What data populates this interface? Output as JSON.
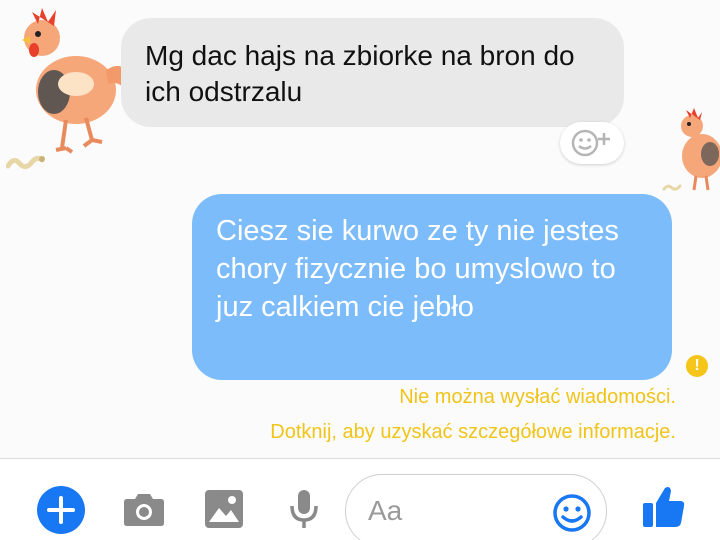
{
  "thread": {
    "incoming_message": "Mg dac hajs na zbiorke na bron do ich odstrzalu",
    "outgoing_message": "Ciesz sie kurwo ze ty nie jestes chory fizycznie bo umyslowo to juz calkiem cie jebło",
    "error_badge": "!",
    "error_title": "Nie można wysłać wiadomości.",
    "error_detail": "Dotknij, aby uzyskać szczegółowe informacje."
  },
  "composer": {
    "placeholder": "Aa",
    "icons": [
      "plus-icon",
      "camera-icon",
      "image-icon",
      "microphone-icon",
      "emoji-icon",
      "thumbs-up-icon"
    ]
  },
  "colors": {
    "incoming_bubble": "#e9e9e9",
    "outgoing_bubble": "#7dbcfb",
    "error_text": "#f0c419",
    "accent": "#1877f2",
    "tool_gray": "#8a8a8a"
  },
  "decorations": [
    "chicken-sticker",
    "worm-sticker"
  ]
}
